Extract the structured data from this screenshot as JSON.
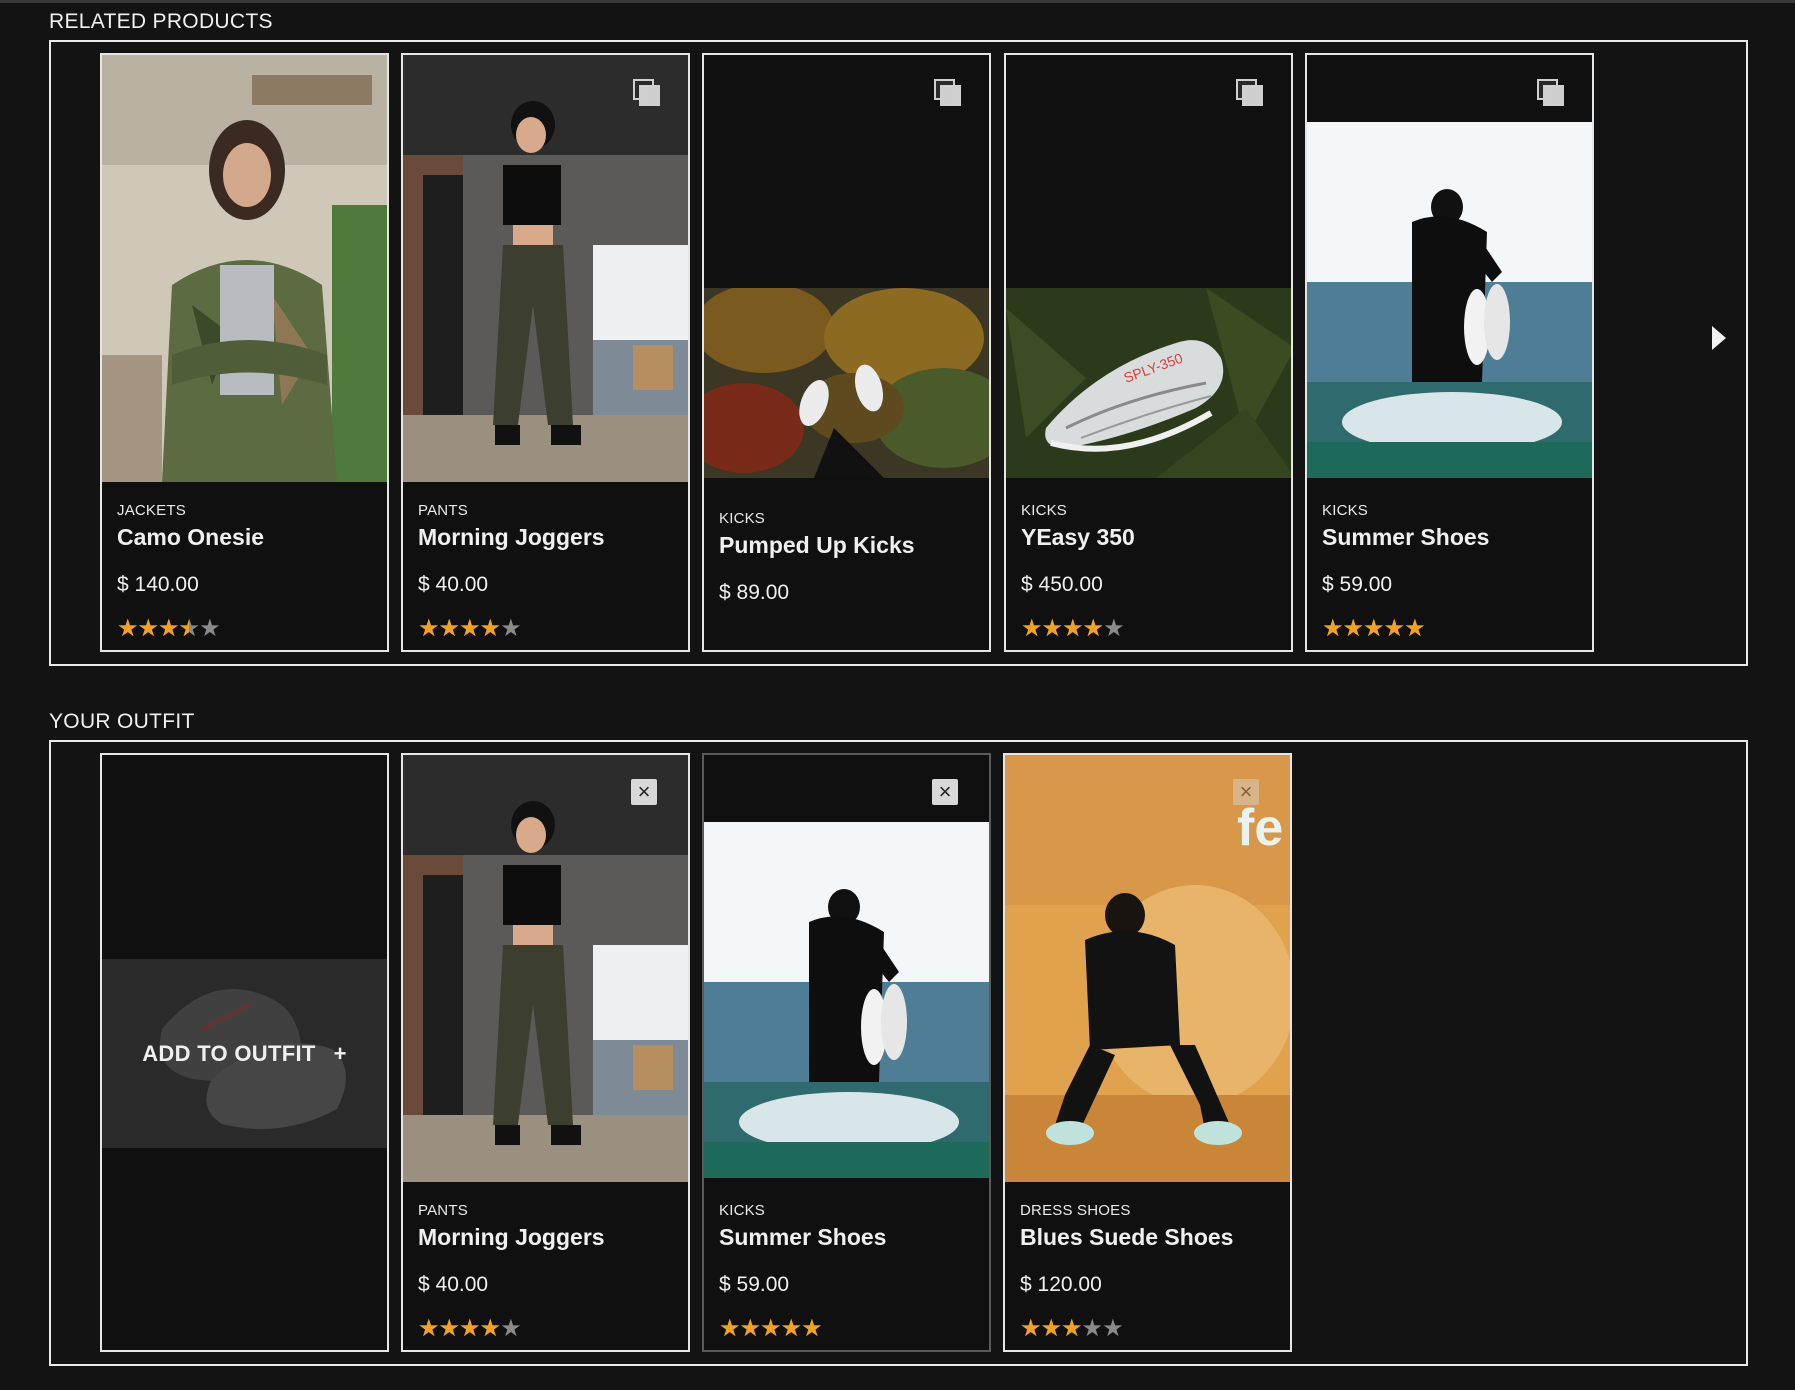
{
  "related": {
    "title": "RELATED PRODUCTS",
    "next_icon": "caret-right-icon",
    "cards": [
      {
        "category": "JACKETS",
        "name": "Camo Onesie",
        "price": "$ 140.00",
        "rating": 3.5,
        "action_icon": "compare-icon"
      },
      {
        "category": "PANTS",
        "name": "Morning Joggers",
        "price": "$ 40.00",
        "rating": 4,
        "action_icon": "compare-icon"
      },
      {
        "category": "KICKS",
        "name": "Pumped Up Kicks",
        "price": "$ 89.00",
        "rating": null,
        "action_icon": "compare-icon"
      },
      {
        "category": "KICKS",
        "name": "YEasy 350",
        "price": "$ 450.00",
        "rating": 4,
        "action_icon": "compare-icon"
      },
      {
        "category": "KICKS",
        "name": "Summer Shoes",
        "price": "$ 59.00",
        "rating": 5,
        "action_icon": "compare-icon"
      }
    ]
  },
  "outfit": {
    "title": "YOUR OUTFIT",
    "add_label": "ADD TO OUTFIT",
    "add_plus": "+",
    "cards": [
      {
        "category": "PANTS",
        "name": "Morning Joggers",
        "price": "$ 40.00",
        "rating": 4,
        "action_icon": "close-icon"
      },
      {
        "category": "KICKS",
        "name": "Summer Shoes",
        "price": "$ 59.00",
        "rating": 5,
        "action_icon": "close-icon"
      },
      {
        "category": "DRESS SHOES",
        "name": "Blues Suede Shoes",
        "price": "$ 120.00",
        "rating": 3,
        "action_icon": "close-icon"
      }
    ]
  },
  "colors": {
    "background": "#131313",
    "star": "#f3a21c",
    "star_empty": "#8a8a8a",
    "border": "#e9e9e9"
  }
}
